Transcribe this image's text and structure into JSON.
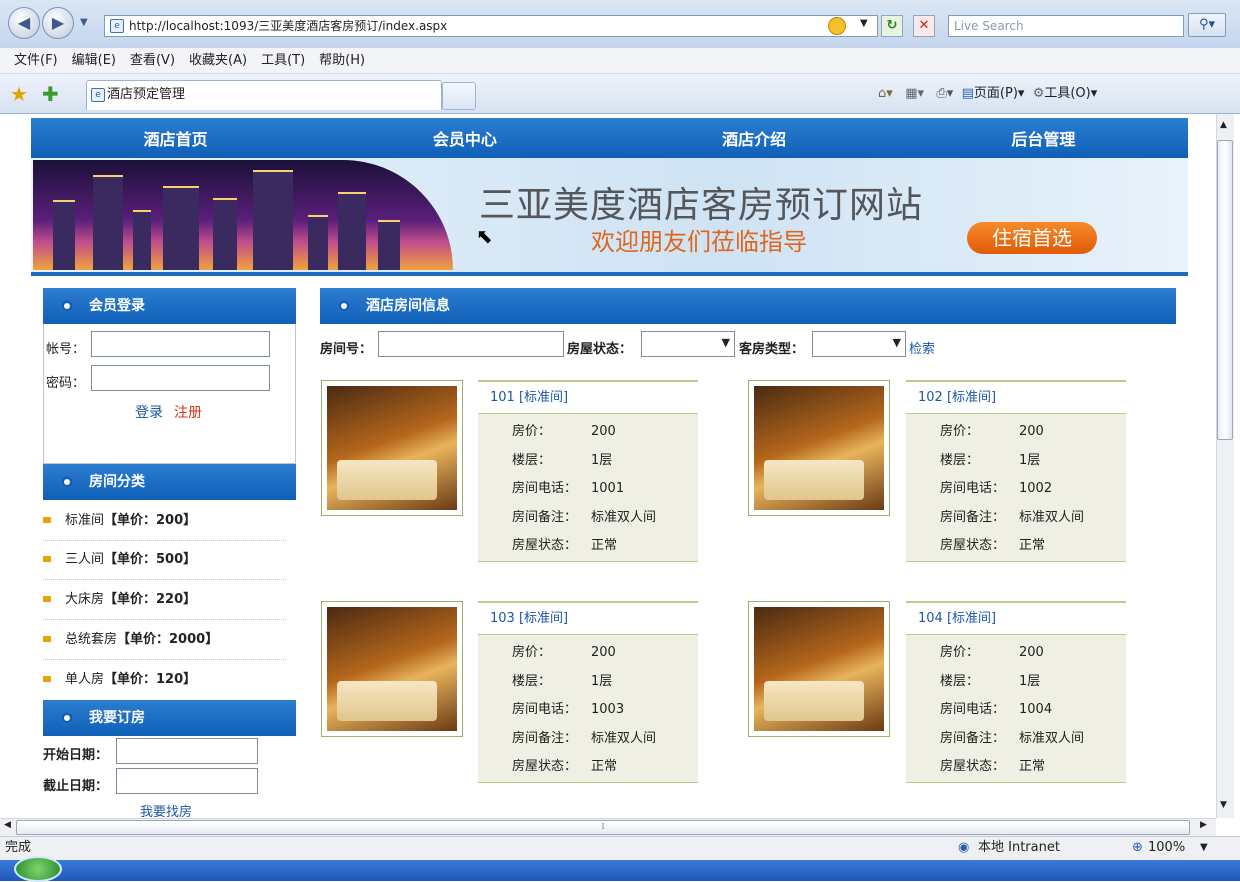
{
  "browser": {
    "url": "http://localhost:1093/三亚美度酒店客房预订/index.aspx",
    "search_placeholder": "Live Search",
    "menu": [
      "文件(F)",
      "编辑(E)",
      "查看(V)",
      "收藏夹(A)",
      "工具(T)",
      "帮助(H)"
    ],
    "tab_title": "酒店预定管理",
    "cmd_page": "页面(P)",
    "cmd_tools": "工具(O)",
    "status_text": "完成",
    "zone": "本地 Intranet",
    "zoom": "100%"
  },
  "nav": [
    "酒店首页",
    "会员中心",
    "酒店介绍",
    "后台管理"
  ],
  "banner": {
    "title": "三亚美度酒店客房预订网站",
    "subtitle": "欢迎朋友们莅临指导",
    "button": "住宿首选"
  },
  "login": {
    "header": "会员登录",
    "account_label": "帐号：",
    "password_label": "密码：",
    "login_link": "登录",
    "register_link": "注册"
  },
  "categories": {
    "header": "房间分类",
    "items": [
      {
        "name": "标准间",
        "price": "【单价：200】"
      },
      {
        "name": "三人间",
        "price": "【单价：500】"
      },
      {
        "name": "大床房",
        "price": "【单价：220】"
      },
      {
        "name": "总统套房",
        "price": "【单价：2000】"
      },
      {
        "name": "单人房",
        "price": "【单价：120】"
      }
    ]
  },
  "booking": {
    "header": "我要订房",
    "start_label": "开始日期：",
    "end_label": "截止日期：",
    "find_link": "我要找房"
  },
  "rooms_panel": {
    "header": "酒店房间信息",
    "room_no_label": "房间号：",
    "status_label": "房屋状态：",
    "type_label": "客房类型：",
    "search_link": "检索",
    "field_labels": {
      "price": "房价：",
      "floor": "楼层：",
      "phone": "房间电话：",
      "note": "房间备注：",
      "state": "房屋状态："
    },
    "rooms": [
      {
        "title": "101 [标准间]",
        "price": "200",
        "floor": "1层",
        "phone": "1001",
        "note": "标准双人间",
        "state": "正常"
      },
      {
        "title": "102 [标准间]",
        "price": "200",
        "floor": "1层",
        "phone": "1002",
        "note": "标准双人间",
        "state": "正常"
      },
      {
        "title": "103 [标准间]",
        "price": "200",
        "floor": "1层",
        "phone": "1003",
        "note": "标准双人间",
        "state": "正常"
      },
      {
        "title": "104 [标准间]",
        "price": "200",
        "floor": "1层",
        "phone": "1004",
        "note": "标准双人间",
        "state": "正常"
      }
    ]
  },
  "colors": {
    "nav_blue": "#1466c0",
    "banner_orange": "#e0661a",
    "room_panel_bg": "#efefe3"
  }
}
